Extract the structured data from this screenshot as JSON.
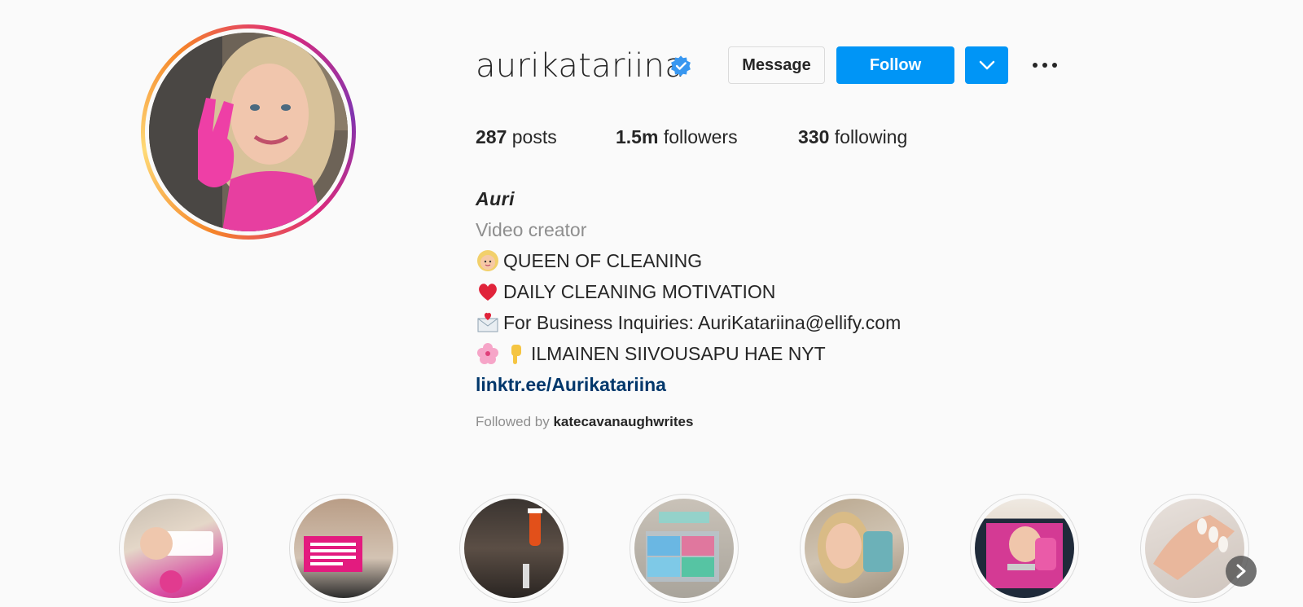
{
  "profile": {
    "username": "aurikatariina",
    "verified": true,
    "buttons": {
      "message": "Message",
      "follow": "Follow"
    },
    "stats": {
      "posts_count": "287",
      "posts_label": "posts",
      "followers_count": "1.5m",
      "followers_label": "followers",
      "following_count": "330",
      "following_label": "following"
    },
    "bio": {
      "name": "Auri",
      "category": "Video creator",
      "lines": [
        {
          "icon": "woman-emoji-icon",
          "text": "QUEEN OF CLEANING"
        },
        {
          "icon": "heart-emoji-icon",
          "text": "DAILY CLEANING MOTIVATION"
        },
        {
          "icon": "envelope-heart-emoji-icon",
          "text": "For Business Inquiries: AuriKatariina@ellify.com"
        },
        {
          "icon": "blossom-pointing-down-emoji-icon",
          "text": "ILMAINEN SIIVOUSAPU HAE NYT"
        }
      ],
      "link": "linktr.ee/Aurikatariina"
    },
    "followed_by_prefix": "Followed by",
    "followed_by_user": "katecavanaughwrites"
  },
  "highlights": [
    {
      "icon": "story-highlight-1"
    },
    {
      "icon": "story-highlight-2"
    },
    {
      "icon": "story-highlight-3"
    },
    {
      "icon": "story-highlight-4"
    },
    {
      "icon": "story-highlight-5"
    },
    {
      "icon": "story-highlight-6"
    },
    {
      "icon": "story-highlight-7"
    }
  ],
  "colors": {
    "accent_blue": "#0095f6",
    "link_blue": "#00376b",
    "secondary_text": "#8e8e8e",
    "primary_text": "#262626",
    "background": "#fafafa"
  }
}
